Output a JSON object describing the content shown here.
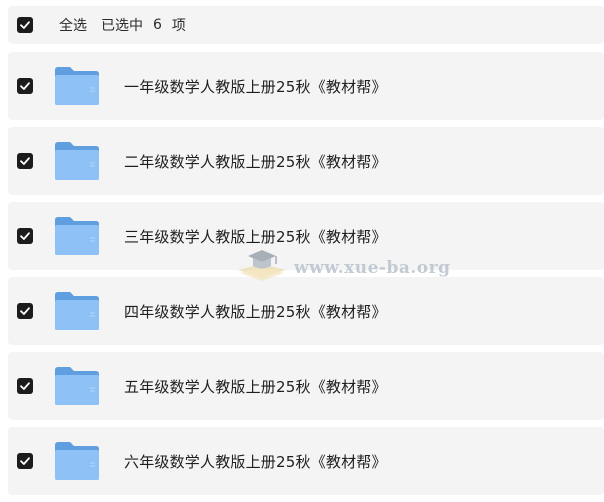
{
  "header": {
    "select_all_label": "全选",
    "selected_prefix": "已选中",
    "selected_count": "6",
    "selected_suffix": "项"
  },
  "files": [
    {
      "name": "一年级数学人教版上册25秋《教材帮》",
      "checked": true,
      "icon": "folder-icon"
    },
    {
      "name": "二年级数学人教版上册25秋《教材帮》",
      "checked": true,
      "icon": "folder-icon"
    },
    {
      "name": "三年级数学人教版上册25秋《教材帮》",
      "checked": true,
      "icon": "folder-icon"
    },
    {
      "name": "四年级数学人教版上册25秋《教材帮》",
      "checked": true,
      "icon": "folder-icon"
    },
    {
      "name": "五年级数学人教版上册25秋《教材帮》",
      "checked": true,
      "icon": "folder-icon"
    },
    {
      "name": "六年级数学人教版上册25秋《教材帮》",
      "checked": true,
      "icon": "folder-icon"
    }
  ],
  "watermark": {
    "text": "www.xue-ba.org"
  },
  "colors": {
    "row_background": "#f4f4f5",
    "checkbox_fill": "#1c1c1c",
    "folder_back": "#5f9fe0",
    "folder_front": "#8ec2f7"
  }
}
